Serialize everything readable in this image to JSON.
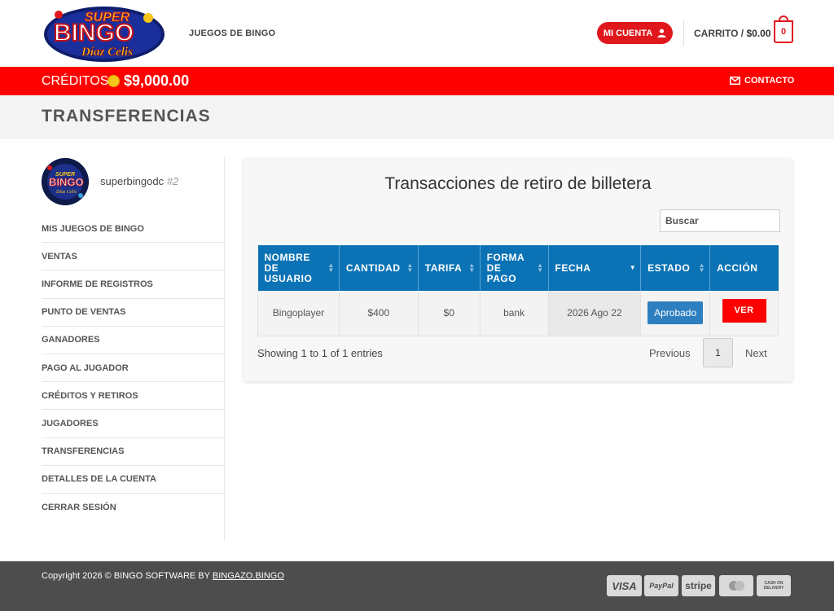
{
  "header": {
    "logo_text": "SUPER BINGO Díaz Celis",
    "nav_games": "JUEGOS DE BINGO",
    "account_label": "MI CUENTA",
    "cart_label": "CARRITO /",
    "cart_amount": "$0.00",
    "cart_count": "0"
  },
  "redbar": {
    "credits_label": "CRÉDITOS",
    "credits_amount": "$9,000.00",
    "contact_label": "CONTACTO"
  },
  "page": {
    "title": "TRANSFERENCIAS"
  },
  "sidebar": {
    "username": "superbingodc",
    "user_id": "#2",
    "items": [
      {
        "label": "MIS JUEGOS DE BINGO"
      },
      {
        "label": "VENTAS"
      },
      {
        "label": "INFORME DE REGISTROS"
      },
      {
        "label": "PUNTO DE VENTAS"
      },
      {
        "label": "GANADORES"
      },
      {
        "label": "PAGO AL JUGADOR"
      },
      {
        "label": "CRÉDITOS Y RETIROS"
      },
      {
        "label": "JUGADORES"
      },
      {
        "label": "TRANSFERENCIAS"
      },
      {
        "label": "DETALLES DE LA CUENTA"
      },
      {
        "label": "CERRAR SESIÓN"
      }
    ]
  },
  "main": {
    "card_title": "Transacciones de retiro de billetera",
    "search_placeholder": "Buscar",
    "columns": [
      "NOMBRE DE USUARIO",
      "CANTIDAD",
      "TARIFA",
      "FORMA DE PAGO",
      "FECHA",
      "ESTADO",
      "ACCIÓN"
    ],
    "rows": [
      {
        "user": "Bingoplayer",
        "amount": "$400",
        "fee": "$0",
        "method": "bank",
        "date": "2026 Ago 22",
        "status": "Aprobado",
        "action": "VER"
      }
    ],
    "info": "Showing 1 to 1 of 1 entries",
    "pagination": {
      "previous": "Previous",
      "page": "1",
      "next": "Next"
    }
  },
  "footer": {
    "copyright": "Copyright 2026 © BINGO SOFTWARE BY",
    "link": "BINGAZO.BINGO",
    "payments": {
      "visa": "VISA",
      "paypal": "PayPal",
      "stripe": "stripe",
      "cod": "CASH ON DELIVERY"
    }
  },
  "colors": {
    "brand_red": "#ff0000",
    "table_header": "#0b73b5",
    "badge": "#2d7fc0",
    "footer": "#4d4d4d"
  }
}
